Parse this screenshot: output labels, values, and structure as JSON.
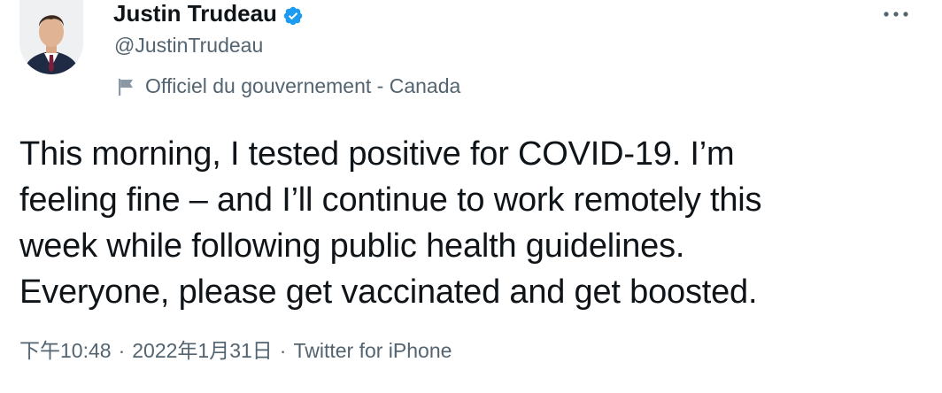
{
  "author": {
    "name": "Justin Trudeau",
    "handle": "@JustinTrudeau",
    "verified": true,
    "label": "Officiel du gouvernement - Canada",
    "avatar_icon": "profile-photo"
  },
  "tweet": {
    "text": "This morning, I tested positive for COVID-19. I’m\nfeeling fine – and I’ll continue to work remotely this\nweek while following public health guidelines.\nEveryone, please get vaccinated and get boosted."
  },
  "meta": {
    "time": "下午10:48",
    "separator": "·",
    "date": "2022年1月31日",
    "source": "Twitter for iPhone"
  },
  "icons": {
    "verified": "verified-badge-icon",
    "government": "flag-icon",
    "more": "more-dots-icon"
  },
  "colors": {
    "text_primary": "#0f1419",
    "text_secondary": "#536471",
    "verified_blue": "#1d9bf0"
  }
}
